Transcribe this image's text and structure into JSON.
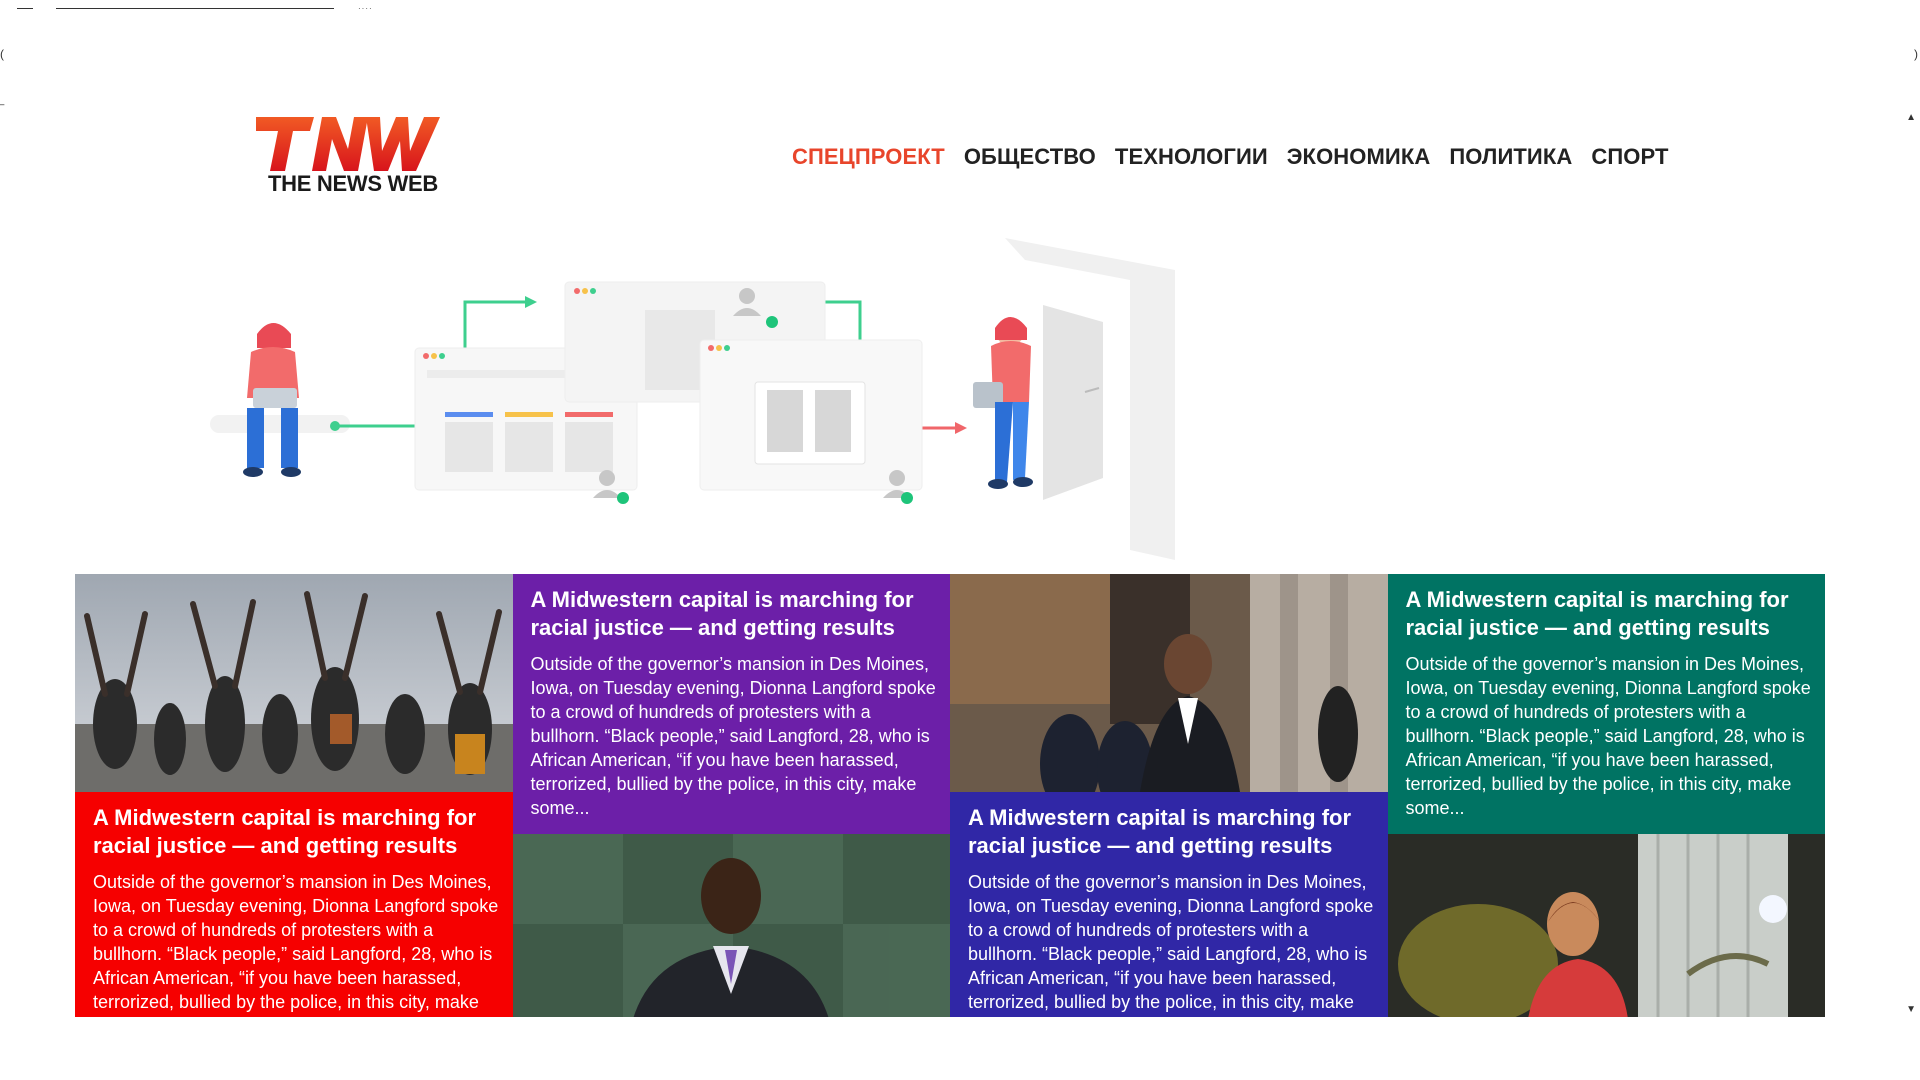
{
  "brand": {
    "logo_text": "TNW",
    "tagline": "THE NEWS WEB",
    "colors": {
      "primary": "#e8452b",
      "dark": "#1a1a1a"
    }
  },
  "nav": {
    "items": [
      {
        "label": "СПЕЦПРОЕКТ",
        "active": true
      },
      {
        "label": "ОБЩЕСТВО",
        "active": false
      },
      {
        "label": "ТЕХНОЛОГИИ",
        "active": false
      },
      {
        "label": "ЭКОНОМИКА",
        "active": false
      },
      {
        "label": "ПОЛИТИКА",
        "active": false
      },
      {
        "label": "СПОРТ",
        "active": false
      }
    ]
  },
  "hero": {
    "illustration": "workflow-people-dashboards-door"
  },
  "cards": [
    {
      "color": "#f60000",
      "image": "protest-crowd-raised-hands-photo",
      "title": "A Midwestern capital is marching for racial justice — and getting results",
      "body": "Outside of the governor’s mansion in Des Moines, Iowa, on Tuesday evening, Dionna Langford spoke to a crowd of hundreds of protesters with a bullhorn. “Black people,” said Langford, 28, who is African American, “if you have been harassed, terrorized, bullied by the police, in this city, make some..."
    },
    {
      "color": "#6c1fa8",
      "image": "speaker-at-podium-green-marble-photo",
      "title": "A Midwestern capital is marching for racial justice — and getting results",
      "body": "Outside of the governor’s mansion in Des Moines, Iowa, on Tuesday evening, Dionna Langford spoke to a crowd of hundreds of protesters with a bullhorn. “Black people,” said Langford, 28, who is African American, “if you have been harassed, terrorized, bullied by the police, in this city, make some..."
    },
    {
      "color": "#3027a6",
      "image": "man-with-police-officers-rotunda-photo",
      "title": "A Midwestern capital is marching for racial justice — and getting results",
      "body": "Outside of the governor’s mansion in Des Moines, Iowa, on Tuesday evening, Dionna Langford spoke to a crowd of hundreds of protesters with a bullhorn. “Black people,” said Langford, 28, who is African American, “if you have been harassed, terrorized, bullied by the police, in this city, make some..."
    },
    {
      "color": "#007363",
      "image": "woman-working-at-desk-lamp-photo",
      "title": "A Midwestern capital is marching for racial justice — and getting results",
      "body": "Outside of the governor’s mansion in Des Moines, Iowa, on Tuesday evening, Dionna Langford spoke to a crowd of hundreds of protesters with a bullhorn. “Black people,” said Langford, 28, who is African American, “if you have been harassed, terrorized, bullied by the police, in this city, make some..."
    }
  ]
}
